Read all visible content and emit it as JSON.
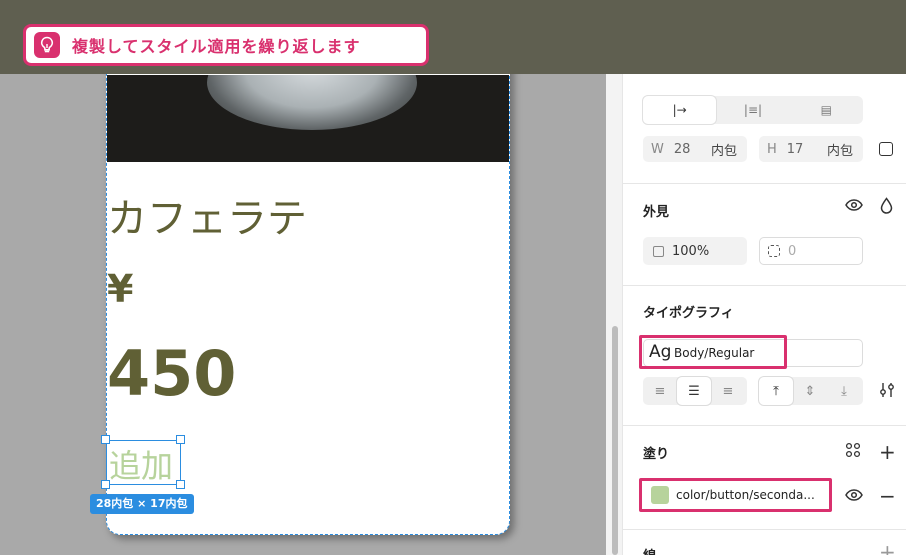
{
  "tip": {
    "icon": "lightbulb-icon",
    "text": "複製してスタイル適用を繰り返します"
  },
  "card": {
    "name": "カフェラテ",
    "currency": "¥",
    "price": "450",
    "selected_text": "追加",
    "size_badge": "28内包 × 17内包"
  },
  "panel": {
    "layout_segments": [
      "|→",
      "|≡|",
      "▤"
    ],
    "width": {
      "label": "W",
      "value": "28",
      "mode": "内包"
    },
    "height": {
      "label": "H",
      "value": "17",
      "mode": "内包"
    },
    "appearance": {
      "title": "外見",
      "opacity": "100%",
      "radius": "0"
    },
    "typography": {
      "title": "タイポグラフィ",
      "sample": "Ag",
      "style_name": "Body/Regular",
      "h_align": [
        "≡",
        "☰",
        "≡"
      ],
      "v_align": [
        "⤒",
        "⇕",
        "⤓"
      ]
    },
    "fill": {
      "title": "塗り",
      "color_name": "color/button/seconda...",
      "swatch_color": "#b7d39c"
    },
    "stroke": {
      "title": "線"
    }
  },
  "colors": {
    "accent": "#d9306e",
    "selection": "#2b8de0",
    "text_olive": "#606035"
  }
}
